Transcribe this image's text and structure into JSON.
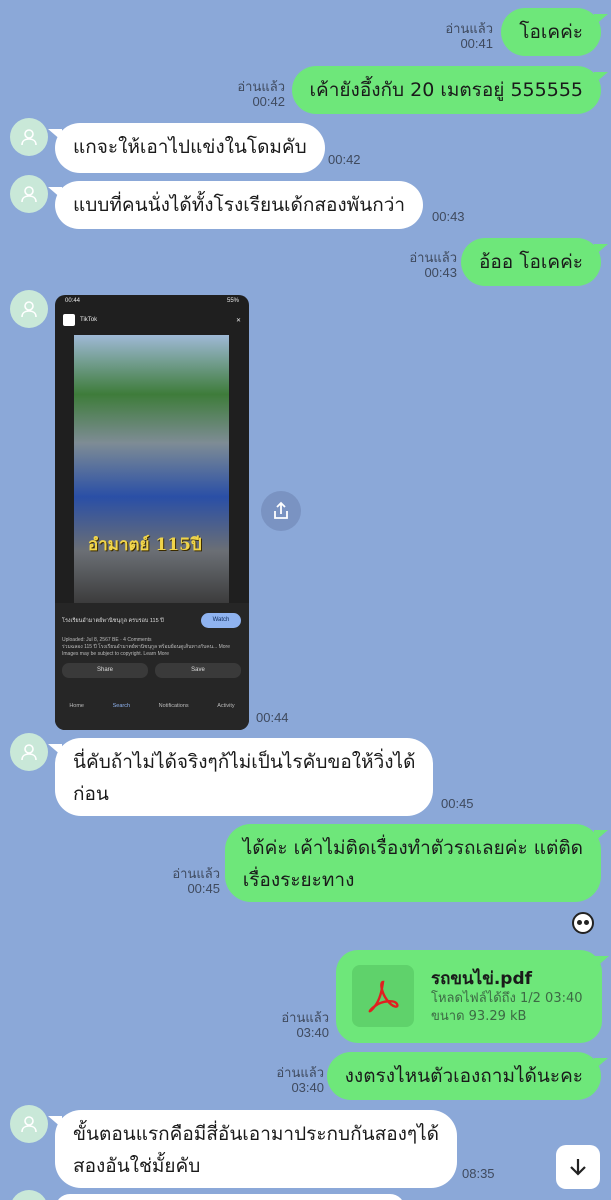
{
  "messages": [
    {
      "text": "โอเคค่ะ",
      "read": "อ่านแล้ว",
      "time": "00:41"
    },
    {
      "text": "เค้ายังอึ้งกับ 20 เมตรอยู่ 555555",
      "read": "อ่านแล้ว",
      "time": "00:42"
    },
    {
      "text": "แกจะให้เอาไปแข่งในโดมคับ",
      "time": "00:42"
    },
    {
      "text": "แบบที่คนนั่งได้ทั้งโรงเรียนเด้กสองพันกว่า",
      "time": "00:43"
    },
    {
      "text": "อ้ออ โอเคค่ะ",
      "read": "อ่านแล้ว",
      "time": "00:43"
    },
    {
      "time": "00:44"
    },
    {
      "line1": "นี่คับถ้าไม่ได้จริงๆก้ไม่เป็นไรคับขอให้วิ่งได้",
      "line2": "ก่อน",
      "time": "00:45"
    },
    {
      "line1": "ได้ค่ะ เค้าไม่ติดเรื่องทำตัวรถเลยค่ะ แต่ติด",
      "line2": "เรื่องระยะทาง",
      "read": "อ่านแล้ว",
      "time": "00:45"
    },
    {
      "read": "อ่านแล้ว",
      "time": "03:40"
    },
    {
      "text": "งงตรงไหนตัวเองถามได้นะคะ",
      "read": "อ่านแล้ว",
      "time": "03:40"
    },
    {
      "line1": "ขั้นตอนแรกคือมีสี่อันเอามาประกบกันสองๆได้",
      "line2": "สองอันใช่มั้ยคับ",
      "time": "08:35"
    }
  ],
  "file": {
    "name": "รถขนไข่.pdf",
    "status": "โหลดไฟล์ได้ถึง 1/2 03:40",
    "size": "ขนาด 93.29 kB"
  },
  "screenshot": {
    "status_time": "00:44",
    "battery": "55%",
    "app": "TikTok",
    "caption": "อำมาตย์ 115ปี",
    "video_title": "โรงเรียนอำมาตย์พานิชนุกูล ครบรอบ 115 ปี",
    "watch": "Watch",
    "uploaded": "Uploaded: Jul 8, 2567 BE · 4 Comments",
    "desc": "ร่วมฉลอง 115 ปี โรงเรียนอำมาตย์พานิชนุกูล พร้อมย้อนดูเส้นทางกับคน... More",
    "copyright": "Images may be subject to copyright. Learn More",
    "share": "Share",
    "save": "Save",
    "nav": [
      "Home",
      "Search",
      "Notifications",
      "Activity"
    ]
  },
  "icons": {
    "avatar": "person-icon",
    "share": "share-icon",
    "pdf": "pdf-icon",
    "scroll": "arrow-down-icon",
    "sticker": "panda-sticker-icon"
  },
  "colors": {
    "background": "#8ba8d8",
    "my_bubble": "#6ee77a",
    "their_bubble": "#ffffff"
  }
}
